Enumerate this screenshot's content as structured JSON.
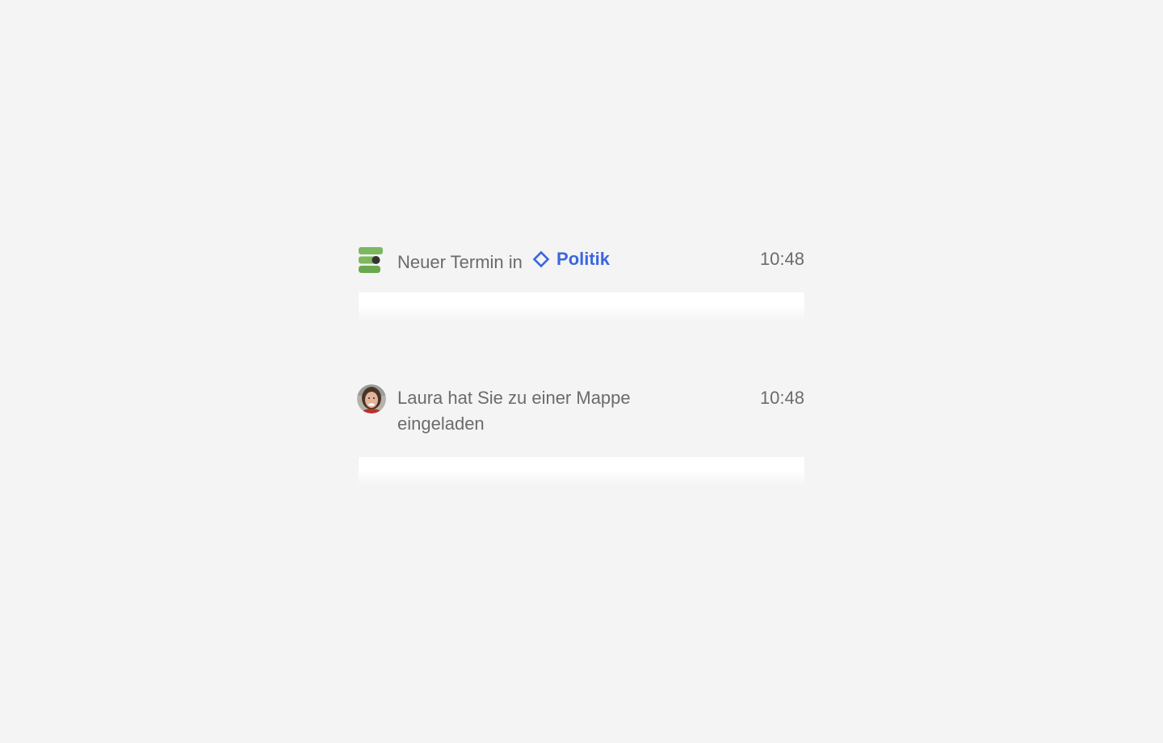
{
  "notifications": [
    {
      "text": "Neuer Termin in",
      "folder": "Politik",
      "time": "10:48",
      "icon": "app-logo-icon"
    },
    {
      "text": "Laura hat Sie zu einer Mappe eingeladen",
      "time": "10:48",
      "icon": "avatar"
    }
  ],
  "colors": {
    "background": "#f4f4f4",
    "text": "#6b6b6b",
    "link": "#3b66e0",
    "logo_green": "#7cb85e",
    "logo_dark": "#333333"
  }
}
